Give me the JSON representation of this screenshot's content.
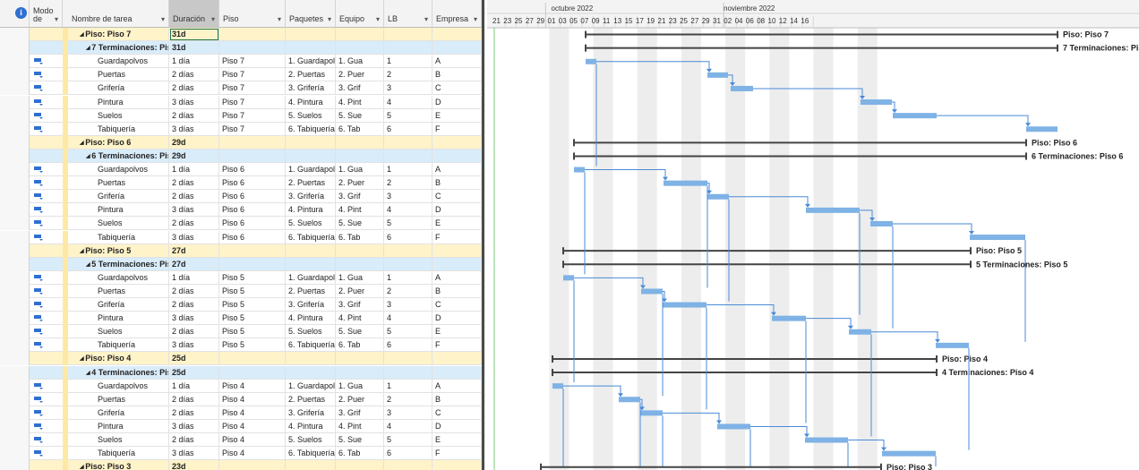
{
  "columns": {
    "info": "i",
    "mode": "Modo de",
    "name": "Nombre de tarea",
    "duration": "Duración",
    "floor": "Piso",
    "packages": "Paquetes",
    "team": "Equipo",
    "lb": "LB",
    "company": "Empresa"
  },
  "timescale": {
    "months": [
      {
        "label": "octubre 2022"
      },
      {
        "label": "noviembre 2022"
      }
    ],
    "days": [
      "21",
      "23",
      "25",
      "27",
      "29",
      "01",
      "03",
      "05",
      "07",
      "09",
      "11",
      "13",
      "15",
      "17",
      "19",
      "21",
      "23",
      "25",
      "27",
      "29",
      "31",
      "02",
      "04",
      "06",
      "08",
      "10",
      "12",
      "14",
      "16"
    ]
  },
  "rows": [
    {
      "type": "sum1",
      "name": "Piso: Piso 7",
      "duration": "31d"
    },
    {
      "type": "sum2",
      "name": "7  Terminaciones: Piso 7",
      "duration": "31d"
    },
    {
      "type": "task",
      "name": "Guardapolvos",
      "duration": "1 día",
      "floor": "Piso 7",
      "packages": "1. Guardapolvos",
      "team": "1. Gua",
      "lb": "1",
      "company": "A"
    },
    {
      "type": "task",
      "name": "Puertas",
      "duration": "2 días",
      "floor": "Piso 7",
      "packages": "2. Puertas",
      "team": "2. Puer",
      "lb": "2",
      "company": "B"
    },
    {
      "type": "task",
      "name": "Grifería",
      "duration": "2 días",
      "floor": "Piso 7",
      "packages": "3. Grifería",
      "team": "3. Grif",
      "lb": "3",
      "company": "C"
    },
    {
      "type": "task",
      "name": "Pintura",
      "duration": "3 días",
      "floor": "Piso 7",
      "packages": "4. Pintura",
      "team": "4. Pint",
      "lb": "4",
      "company": "D"
    },
    {
      "type": "task",
      "name": "Suelos",
      "duration": "2 días",
      "floor": "Piso 7",
      "packages": "5. Suelos",
      "team": "5. Sue",
      "lb": "5",
      "company": "E"
    },
    {
      "type": "task",
      "name": "Tabiquería",
      "duration": "3 días",
      "floor": "Piso 7",
      "packages": "6. Tabiquería",
      "team": "6. Tab",
      "lb": "6",
      "company": "F"
    },
    {
      "type": "sum1",
      "name": "Piso: Piso 6",
      "duration": "29d"
    },
    {
      "type": "sum2",
      "name": "6  Terminaciones: Piso 6",
      "duration": "29d"
    },
    {
      "type": "task",
      "name": "Guardapolvos",
      "duration": "1 día",
      "floor": "Piso 6",
      "packages": "1. Guardapolvos",
      "team": "1. Gua",
      "lb": "1",
      "company": "A"
    },
    {
      "type": "task",
      "name": "Puertas",
      "duration": "2 días",
      "floor": "Piso 6",
      "packages": "2. Puertas",
      "team": "2. Puer",
      "lb": "2",
      "company": "B"
    },
    {
      "type": "task",
      "name": "Grifería",
      "duration": "2 días",
      "floor": "Piso 6",
      "packages": "3. Grifería",
      "team": "3. Grif",
      "lb": "3",
      "company": "C"
    },
    {
      "type": "task",
      "name": "Pintura",
      "duration": "3 días",
      "floor": "Piso 6",
      "packages": "4. Pintura",
      "team": "4. Pint",
      "lb": "4",
      "company": "D"
    },
    {
      "type": "task",
      "name": "Suelos",
      "duration": "2 días",
      "floor": "Piso 6",
      "packages": "5. Suelos",
      "team": "5. Sue",
      "lb": "5",
      "company": "E"
    },
    {
      "type": "task",
      "name": "Tabiquería",
      "duration": "3 días",
      "floor": "Piso 6",
      "packages": "6. Tabiquería",
      "team": "6. Tab",
      "lb": "6",
      "company": "F"
    },
    {
      "type": "sum1",
      "name": "Piso: Piso 5",
      "duration": "27d"
    },
    {
      "type": "sum2",
      "name": "5  Terminaciones: Piso 5",
      "duration": "27d"
    },
    {
      "type": "task",
      "name": "Guardapolvos",
      "duration": "1 día",
      "floor": "Piso 5",
      "packages": "1. Guardapolvos",
      "team": "1. Gua",
      "lb": "1",
      "company": "A"
    },
    {
      "type": "task",
      "name": "Puertas",
      "duration": "2 días",
      "floor": "Piso 5",
      "packages": "2. Puertas",
      "team": "2. Puer",
      "lb": "2",
      "company": "B"
    },
    {
      "type": "task",
      "name": "Grifería",
      "duration": "2 días",
      "floor": "Piso 5",
      "packages": "3. Grifería",
      "team": "3. Grif",
      "lb": "3",
      "company": "C"
    },
    {
      "type": "task",
      "name": "Pintura",
      "duration": "3 días",
      "floor": "Piso 5",
      "packages": "4. Pintura",
      "team": "4. Pint",
      "lb": "4",
      "company": "D"
    },
    {
      "type": "task",
      "name": "Suelos",
      "duration": "2 días",
      "floor": "Piso 5",
      "packages": "5. Suelos",
      "team": "5. Sue",
      "lb": "5",
      "company": "E"
    },
    {
      "type": "task",
      "name": "Tabiquería",
      "duration": "3 días",
      "floor": "Piso 5",
      "packages": "6. Tabiquería",
      "team": "6. Tab",
      "lb": "6",
      "company": "F"
    },
    {
      "type": "sum1",
      "name": "Piso: Piso 4",
      "duration": "25d"
    },
    {
      "type": "sum2",
      "name": "4  Terminaciones: Piso 4",
      "duration": "25d"
    },
    {
      "type": "task",
      "name": "Guardapolvos",
      "duration": "1 día",
      "floor": "Piso 4",
      "packages": "1. Guardapolvos",
      "team": "1. Gua",
      "lb": "1",
      "company": "A"
    },
    {
      "type": "task",
      "name": "Puertas",
      "duration": "2 días",
      "floor": "Piso 4",
      "packages": "2. Puertas",
      "team": "2. Puer",
      "lb": "2",
      "company": "B"
    },
    {
      "type": "task",
      "name": "Grifería",
      "duration": "2 días",
      "floor": "Piso 4",
      "packages": "3. Grifería",
      "team": "3. Grif",
      "lb": "3",
      "company": "C"
    },
    {
      "type": "task",
      "name": "Pintura",
      "duration": "3 días",
      "floor": "Piso 4",
      "packages": "4. Pintura",
      "team": "4. Pint",
      "lb": "4",
      "company": "D"
    },
    {
      "type": "task",
      "name": "Suelos",
      "duration": "2 días",
      "floor": "Piso 4",
      "packages": "5. Suelos",
      "team": "5. Sue",
      "lb": "5",
      "company": "E"
    },
    {
      "type": "task",
      "name": "Tabiquería",
      "duration": "3 días",
      "floor": "Piso 4",
      "packages": "6. Tabiquería",
      "team": "6. Tab",
      "lb": "6",
      "company": "F"
    },
    {
      "type": "sum1",
      "name": "Piso: Piso 3",
      "duration": "23d"
    }
  ],
  "gantt_labels": [
    "Piso: Piso 7",
    "7  Terminaciones: Piso 7",
    "Piso: Piso 6",
    "6  Terminaciones: Piso 6",
    "Piso: Piso 5",
    "5  Terminaciones: Piso 5",
    "Piso: Piso 4",
    "4  Terminaciones: Piso 4",
    "Piso: Piso 3"
  ],
  "colors": {
    "task_bar": "#7fb2e5",
    "link": "#4a8ad6",
    "summary_bar": "#444444",
    "summary_row": "#fff3c9",
    "sub_summary_row": "#d9ecfa",
    "weekend": "#ededed",
    "mode_icon": "#2f6fd1"
  },
  "icons": {
    "info": "info-icon",
    "mode": "auto-schedule-icon",
    "collapse": "collapse-triangle-icon",
    "filter": "dropdown-arrow-icon"
  }
}
